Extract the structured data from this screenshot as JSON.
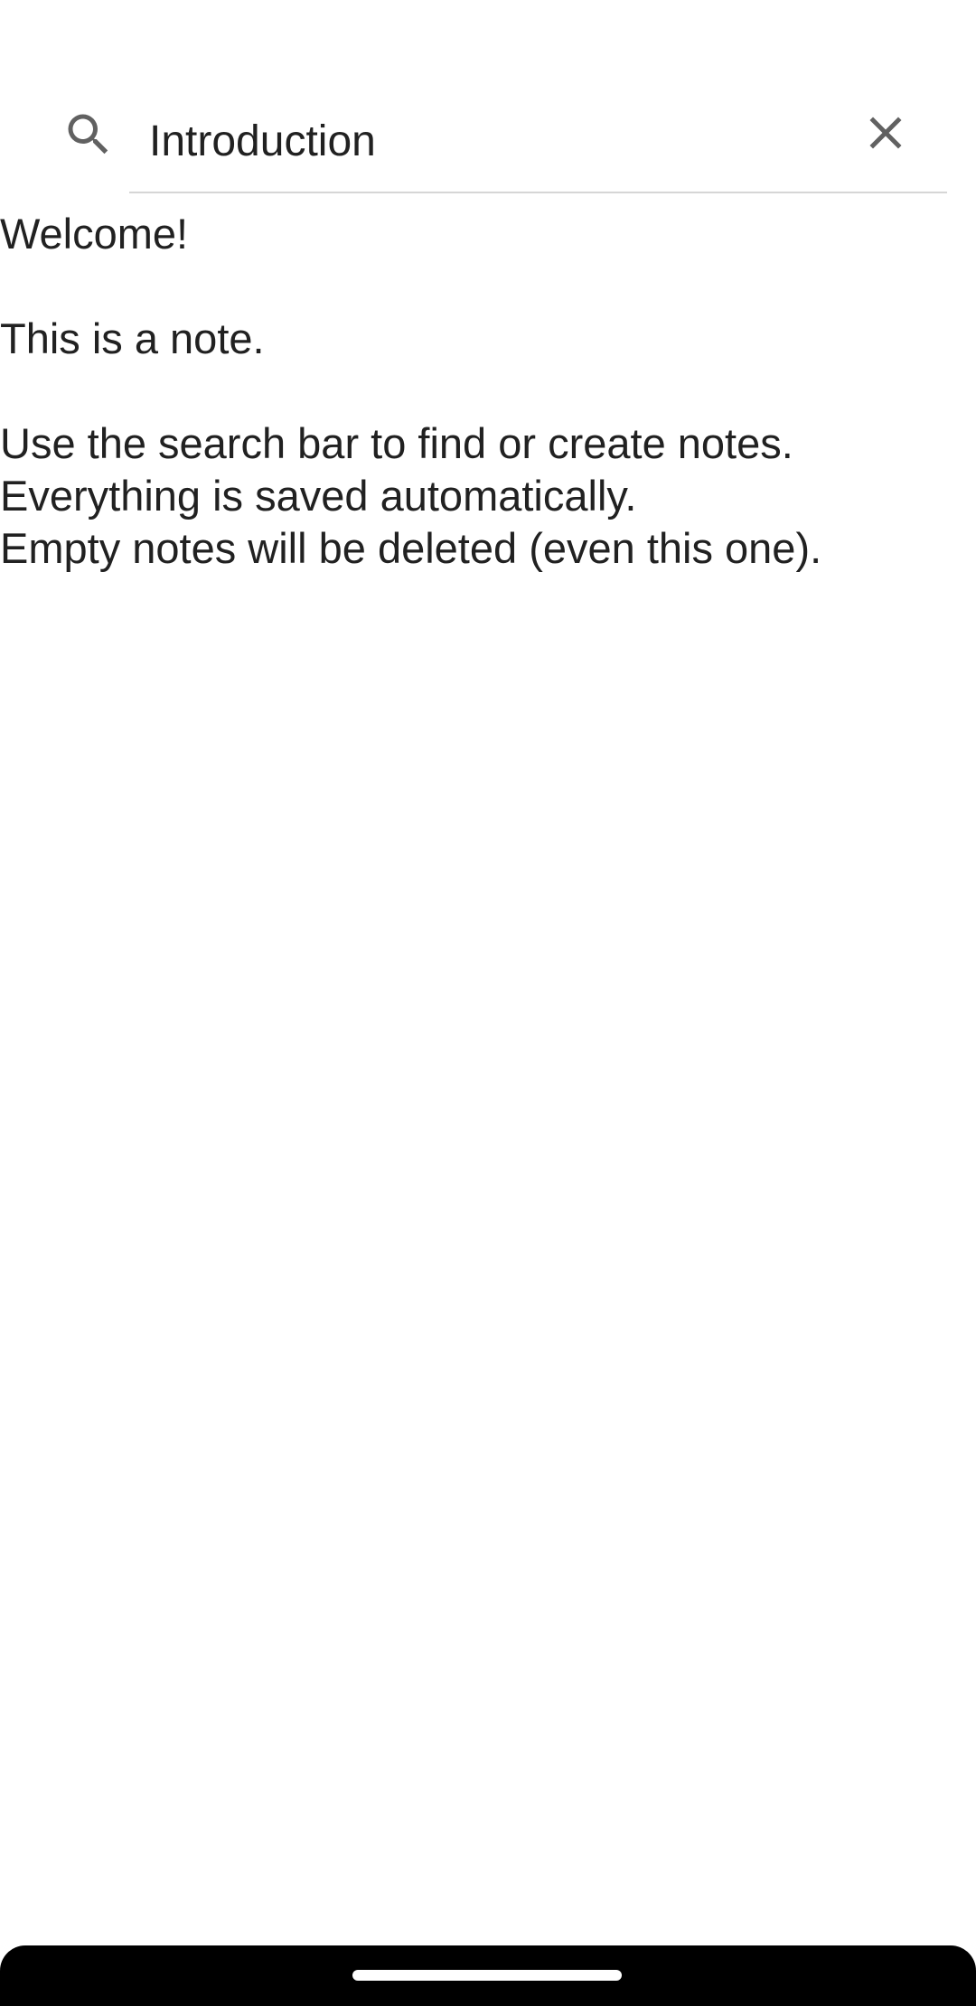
{
  "search": {
    "value": "Introduction",
    "icon": "search-icon",
    "clear_icon": "close-icon"
  },
  "note": {
    "text": "Welcome!\n\nThis is a note.\n\nUse the search bar to find or create notes.\nEverything is saved automatically.\nEmpty notes will be deleted (even this one)."
  },
  "colors": {
    "text": "#212121",
    "icon": "#616161",
    "underline": "#d6d6d6",
    "nav_bar": "#000000"
  }
}
